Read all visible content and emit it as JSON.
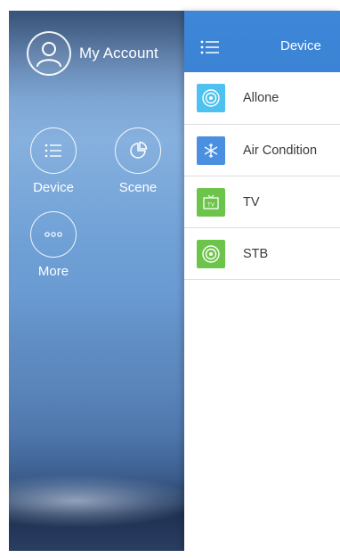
{
  "drawer": {
    "account_label": "My Account",
    "items": [
      {
        "label": "Device",
        "icon": "list-icon"
      },
      {
        "label": "Scene",
        "icon": "pie-chart-icon"
      },
      {
        "label": "More",
        "icon": "more-dots-icon"
      }
    ]
  },
  "main": {
    "title": "Device",
    "menu_icon": "menu-list-icon",
    "devices": [
      {
        "label": "Allone",
        "icon": "allone-icon",
        "color": "#4dc1ef"
      },
      {
        "label": "Air Condition",
        "icon": "snowflake-icon",
        "color": "#4b8fe0"
      },
      {
        "label": "TV",
        "icon": "tv-icon",
        "color": "#6cc44a"
      },
      {
        "label": "STB",
        "icon": "stb-icon",
        "color": "#6cc44a"
      }
    ]
  },
  "colors": {
    "accent": "#3e86d7",
    "allone": "#4dc1ef",
    "air_condition": "#4b8fe0",
    "tv": "#6cc44a",
    "stb": "#6cc44a"
  }
}
